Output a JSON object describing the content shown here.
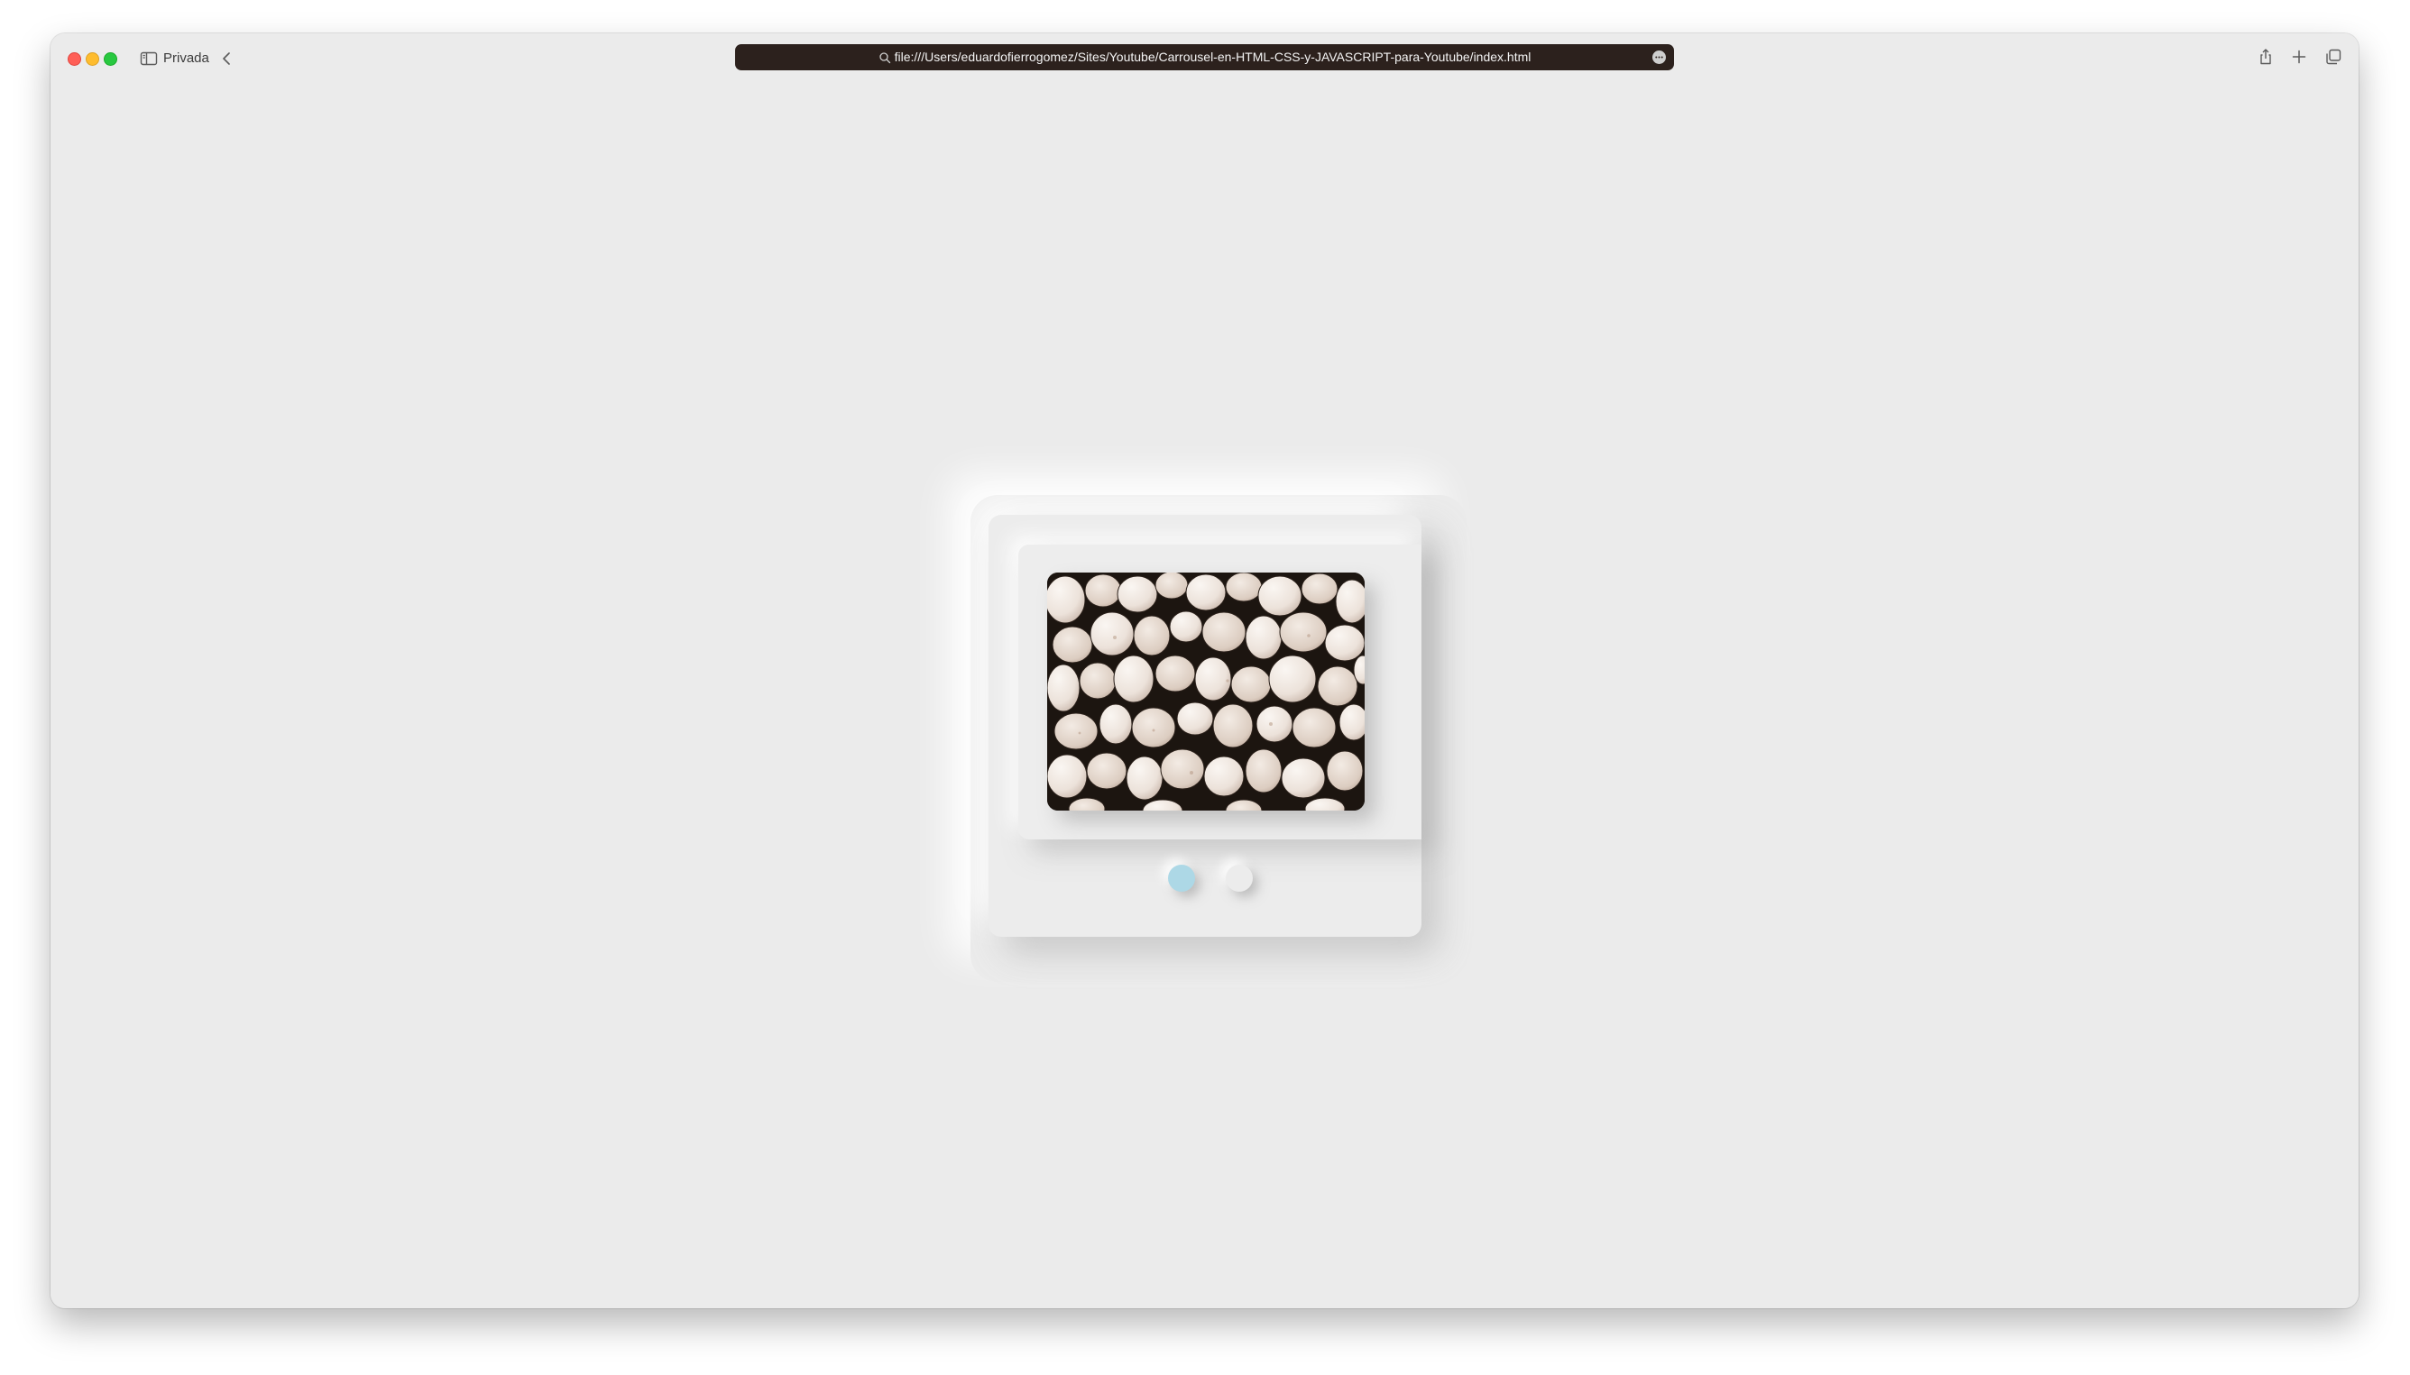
{
  "browser": {
    "window_mode_label": "Privada",
    "url": "file:///Users/eduardofierrogomez/Sites/Youtube/Carrousel-en-HTML-CSS-y-JAVASCRIPT-para-Youtube/index.html",
    "icons": {
      "sidebar": "sidebar-icon",
      "back": "chevron-left-icon",
      "search": "magnifier-icon",
      "reader": "more-icon",
      "share": "share-icon",
      "new_tab": "plus-icon",
      "tabs": "tabs-overview-icon"
    },
    "traffic_lights": {
      "close": "#ff5f57",
      "minimize": "#febc2e",
      "maximize": "#28c840"
    },
    "address_bar_color": "#2c211d"
  },
  "page": {
    "background": "#ebebeb",
    "carousel": {
      "slide_image": "white-pebbles-photo",
      "slide_count": 2,
      "active_index": 0,
      "active_dot_color": "#add8e6",
      "inactive_dot_color": "#ececec"
    }
  }
}
